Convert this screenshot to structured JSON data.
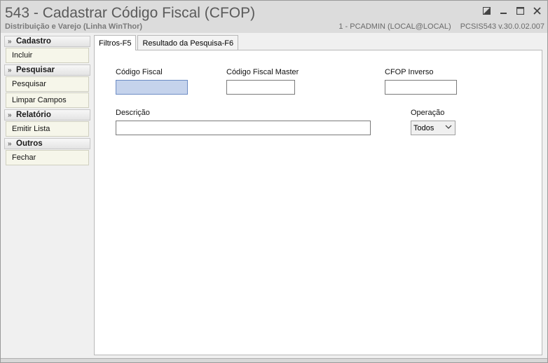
{
  "window": {
    "title": "543 - Cadastrar Código Fiscal (CFOP)",
    "subtitle": "Distribuição e Varejo (Linha WinThor)",
    "user_info": "1 - PCADMIN (LOCAL@LOCAL)",
    "version": "PCSIS543  v.30.0.02.007"
  },
  "sidebar": {
    "groups": [
      {
        "label": "Cadastro",
        "items": [
          {
            "label": "Incluir"
          }
        ]
      },
      {
        "label": "Pesquisar",
        "items": [
          {
            "label": "Pesquisar"
          },
          {
            "label": "Limpar Campos"
          }
        ]
      },
      {
        "label": "Relatório",
        "items": [
          {
            "label": "Emitir Lista"
          }
        ]
      },
      {
        "label": "Outros",
        "items": [
          {
            "label": "Fechar"
          }
        ]
      }
    ]
  },
  "tabs": [
    {
      "label": "Filtros-F5",
      "active": true
    },
    {
      "label": "Resultado da Pesquisa-F6",
      "active": false
    }
  ],
  "form": {
    "codigo_fiscal_label": "Código Fiscal",
    "codigo_fiscal_value": "",
    "codigo_fiscal_master_label": "Código Fiscal Master",
    "codigo_fiscal_master_value": "",
    "cfop_inverso_label": "CFOP Inverso",
    "cfop_inverso_value": "",
    "descricao_label": "Descrição",
    "descricao_value": "",
    "operacao_label": "Operação",
    "operacao_value": "Todos"
  }
}
